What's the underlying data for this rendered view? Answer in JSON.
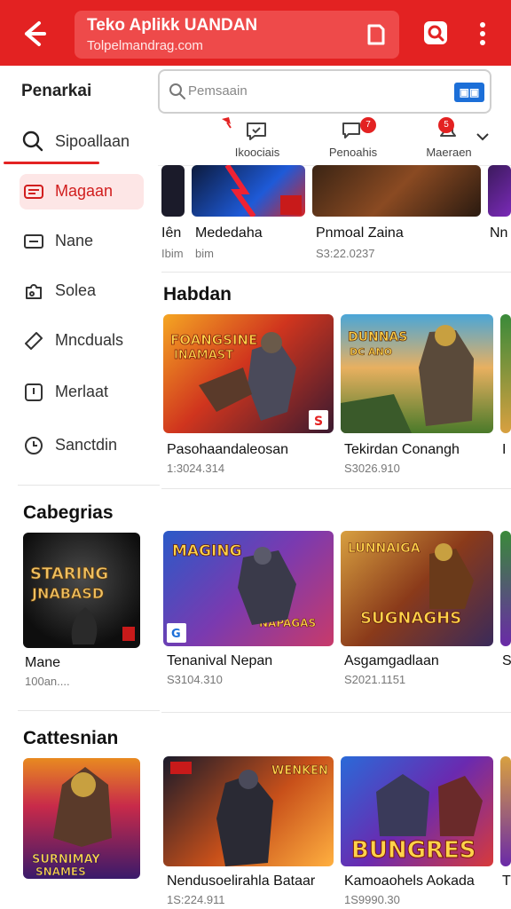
{
  "header": {
    "title": "Teko Aplikk UANDAN",
    "subtitle": "Tolpelmandrag.com",
    "colors": {
      "bar": "#e32222",
      "title_box": "#ee4a4a"
    }
  },
  "sidebar": {
    "heading": "Penarkai",
    "search_label": "Sipoallaan",
    "items": [
      {
        "label": "Magaan",
        "icon": "wallet-icon",
        "active": true
      },
      {
        "label": "Nane",
        "icon": "tag-icon",
        "active": false
      },
      {
        "label": "Solea",
        "icon": "puzzle-icon",
        "active": false
      },
      {
        "label": "Mncduals",
        "icon": "tag-diagonal-icon",
        "active": false
      },
      {
        "label": "Merlaat",
        "icon": "square-icon",
        "active": false
      },
      {
        "label": "Sanctdin",
        "icon": "clock-icon",
        "active": false
      }
    ]
  },
  "search": {
    "placeholder": "Pemsaain"
  },
  "tabs": [
    {
      "label": "Ikoociais",
      "icon": "chat-icon",
      "badge": ""
    },
    {
      "label": "Penoahis",
      "icon": "message-icon",
      "badge": "7"
    },
    {
      "label": "Maeraen",
      "icon": "bell-icon",
      "badge": "5"
    }
  ],
  "top_row": [
    {
      "name": "Iên",
      "size": "Ibim"
    },
    {
      "name": "Mededaha",
      "size": "bim"
    },
    {
      "name": "Pnmoal Zaina",
      "size": "S3:22.0237"
    },
    {
      "name": "Nn",
      "size": ""
    }
  ],
  "sections": [
    {
      "title": "Habdan",
      "cards": [
        {
          "name": "Pasohaandaleosan",
          "size": "1:3024.314",
          "art": "FOANGSINE INAMAST"
        },
        {
          "name": "Tekirdan Conangh",
          "size": "S3026.910",
          "art": "DUNNAS DC ANO"
        },
        {
          "name": "I",
          "size": "",
          "art": ""
        }
      ]
    },
    {
      "title": "Cabegrias",
      "cards": [
        {
          "name": "Mane",
          "size": "100an....",
          "art": "STARING JNABASD"
        },
        {
          "name": "Tenanival Nepan",
          "size": "S3104.310",
          "art": "MAGING NAPAGAS"
        },
        {
          "name": "Asgamgadlaan",
          "size": "S2021.1151",
          "art": "LUNNAIGA SUGNAGHS"
        },
        {
          "name": "S",
          "size": "",
          "art": ""
        }
      ]
    },
    {
      "title": "Cattesnian",
      "cards": [
        {
          "name": "",
          "size": "",
          "art": "SURNIMAY SNAMES"
        },
        {
          "name": "Nendusoelirahla Bataar",
          "size": "1S:224.911",
          "art": "WENKEN"
        },
        {
          "name": "Kamoaohels Aokada",
          "size": "1S9990.30",
          "art": "BUNGRES"
        },
        {
          "name": "T",
          "size": "",
          "art": ""
        }
      ]
    }
  ]
}
